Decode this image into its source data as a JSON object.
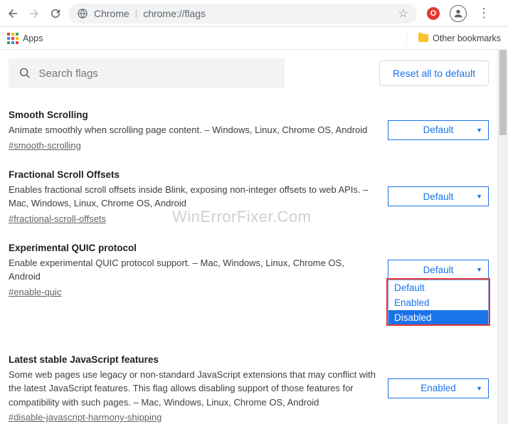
{
  "toolbar": {
    "omnibox_app": "Chrome",
    "omnibox_url": "chrome://flags"
  },
  "bookmarks": {
    "apps": "Apps",
    "other": "Other bookmarks"
  },
  "search": {
    "placeholder": "Search flags",
    "reset": "Reset all to default"
  },
  "flags": [
    {
      "title": "Smooth Scrolling",
      "desc": "Animate smoothly when scrolling page content. – Windows, Linux, Chrome OS, Android",
      "hash": "#smooth-scrolling",
      "value": "Default"
    },
    {
      "title": "Fractional Scroll Offsets",
      "desc": "Enables fractional scroll offsets inside Blink, exposing non-integer offsets to web APIs. – Mac, Windows, Linux, Chrome OS, Android",
      "hash": "#fractional-scroll-offsets",
      "value": "Default"
    },
    {
      "title": "Experimental QUIC protocol",
      "desc": "Enable experimental QUIC protocol support. – Mac, Windows, Linux, Chrome OS, Android",
      "hash": "#enable-quic",
      "value": "Default"
    },
    {
      "title": "Latest stable JavaScript features",
      "desc": "Some web pages use legacy or non-standard JavaScript extensions that may conflict with the latest JavaScript features. This flag allows disabling support of those features for compatibility with such pages. – Mac, Windows, Linux, Chrome OS, Android",
      "hash": "#disable-javascript-harmony-shipping",
      "value": "Enabled"
    }
  ],
  "dropdown": {
    "options": [
      "Default",
      "Enabled",
      "Disabled"
    ],
    "selected": "Disabled"
  },
  "watermark": "WinErrorFixer.Com"
}
